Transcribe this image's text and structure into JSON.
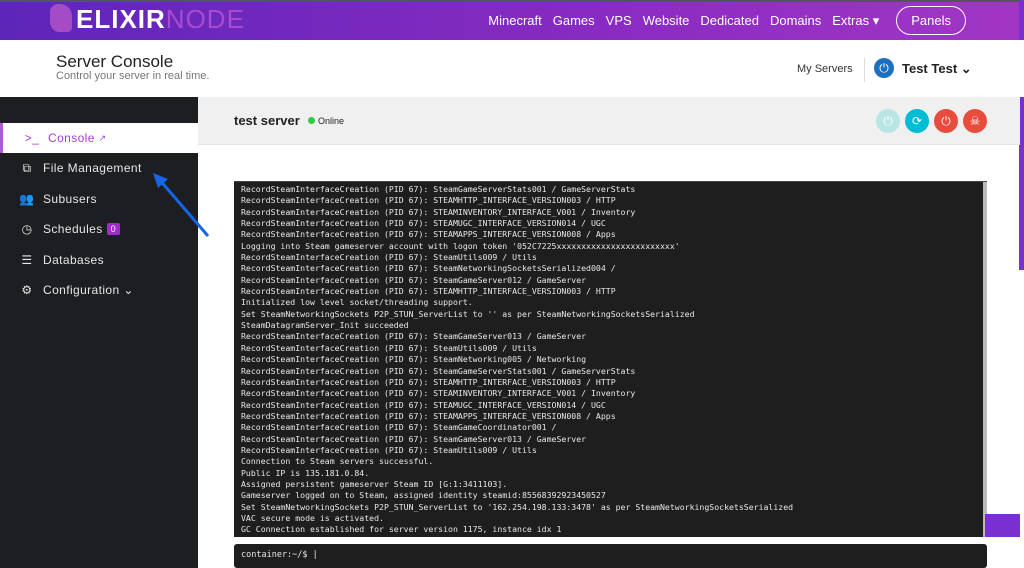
{
  "topbar": {
    "logo_bold": "ELIXIR",
    "logo_light": "NODE",
    "nav": [
      "Minecraft",
      "Games",
      "VPS",
      "Website",
      "Dedicated",
      "Domains",
      "Extras ▾"
    ],
    "panels": "Panels"
  },
  "header": {
    "title": "Server Console",
    "subtitle": "Control your server in real time.",
    "my_servers": "My Servers",
    "user": "Test Test"
  },
  "sidebar": {
    "items": [
      {
        "label": "Console",
        "icon": "terminal-icon"
      },
      {
        "label": "File Management",
        "icon": "files-icon"
      },
      {
        "label": "Subusers",
        "icon": "users-icon"
      },
      {
        "label": "Schedules",
        "icon": "clock-icon",
        "badge": "0"
      },
      {
        "label": "Databases",
        "icon": "database-icon"
      },
      {
        "label": "Configuration",
        "icon": "gears-icon"
      }
    ]
  },
  "server": {
    "name": "test server",
    "status": "Online",
    "status_color": "#2ecc40",
    "buttons": [
      {
        "name": "start",
        "color": "#b9e6e4"
      },
      {
        "name": "restart",
        "color": "#00bcd4"
      },
      {
        "name": "stop",
        "color": "#e74c3c"
      },
      {
        "name": "kill",
        "color": "#e74c3c"
      }
    ]
  },
  "console": {
    "lines": [
      "RecordSteamInterfaceCreation (PID 67): SteamGameServerStats001 / GameServerStats",
      "RecordSteamInterfaceCreation (PID 67): STEAMHTTP_INTERFACE_VERSION003 / HTTP",
      "RecordSteamInterfaceCreation (PID 67): STEAMINVENTORY_INTERFACE_V001 / Inventory",
      "RecordSteamInterfaceCreation (PID 67): STEAMUGC_INTERFACE_VERSION014 / UGC",
      "RecordSteamInterfaceCreation (PID 67): STEAMAPPS_INTERFACE_VERSION008 / Apps",
      "Logging into Steam gameserver account with logon token '052C7225xxxxxxxxxxxxxxxxxxxxxxxx'",
      "RecordSteamInterfaceCreation (PID 67): SteamUtils009 / Utils",
      "RecordSteamInterfaceCreation (PID 67): SteamNetworkingSocketsSerialized004 /",
      "RecordSteamInterfaceCreation (PID 67): SteamGameServer012 / GameServer",
      "RecordSteamInterfaceCreation (PID 67): STEAMHTTP_INTERFACE_VERSION003 / HTTP",
      "Initialized low level socket/threading support.",
      "Set SteamNetworkingSockets P2P_STUN_ServerList to '' as per SteamNetworkingSocketsSerialized",
      "SteamDatagramServer_Init succeeded",
      "RecordSteamInterfaceCreation (PID 67): SteamGameServer013 / GameServer",
      "RecordSteamInterfaceCreation (PID 67): SteamUtils009 / Utils",
      "RecordSteamInterfaceCreation (PID 67): SteamNetworking005 / Networking",
      "RecordSteamInterfaceCreation (PID 67): SteamGameServerStats001 / GameServerStats",
      "RecordSteamInterfaceCreation (PID 67): STEAMHTTP_INTERFACE_VERSION003 / HTTP",
      "RecordSteamInterfaceCreation (PID 67): STEAMINVENTORY_INTERFACE_V001 / Inventory",
      "RecordSteamInterfaceCreation (PID 67): STEAMUGC_INTERFACE_VERSION014 / UGC",
      "RecordSteamInterfaceCreation (PID 67): STEAMAPPS_INTERFACE_VERSION008 / Apps",
      "RecordSteamInterfaceCreation (PID 67): SteamGameCoordinator001 /",
      "RecordSteamInterfaceCreation (PID 67): SteamGameServer013 / GameServer",
      "RecordSteamInterfaceCreation (PID 67): SteamUtils009 / Utils",
      "Connection to Steam servers successful.",
      "Public IP is 135.181.0.84.",
      "Assigned persistent gameserver Steam ID [G:1:3411103].",
      "Gameserver logged on to Steam, assigned identity steamid:85568392923450527",
      "Set SteamNetworkingSockets P2P_STUN_ServerList to '162.254.198.133:3478' as per SteamNetworkingSocketsSerialized",
      "VAC secure mode is activated.",
      "GC Connection established for server version 1175, instance idx 1"
    ],
    "prompt": "container:~/$ |"
  }
}
